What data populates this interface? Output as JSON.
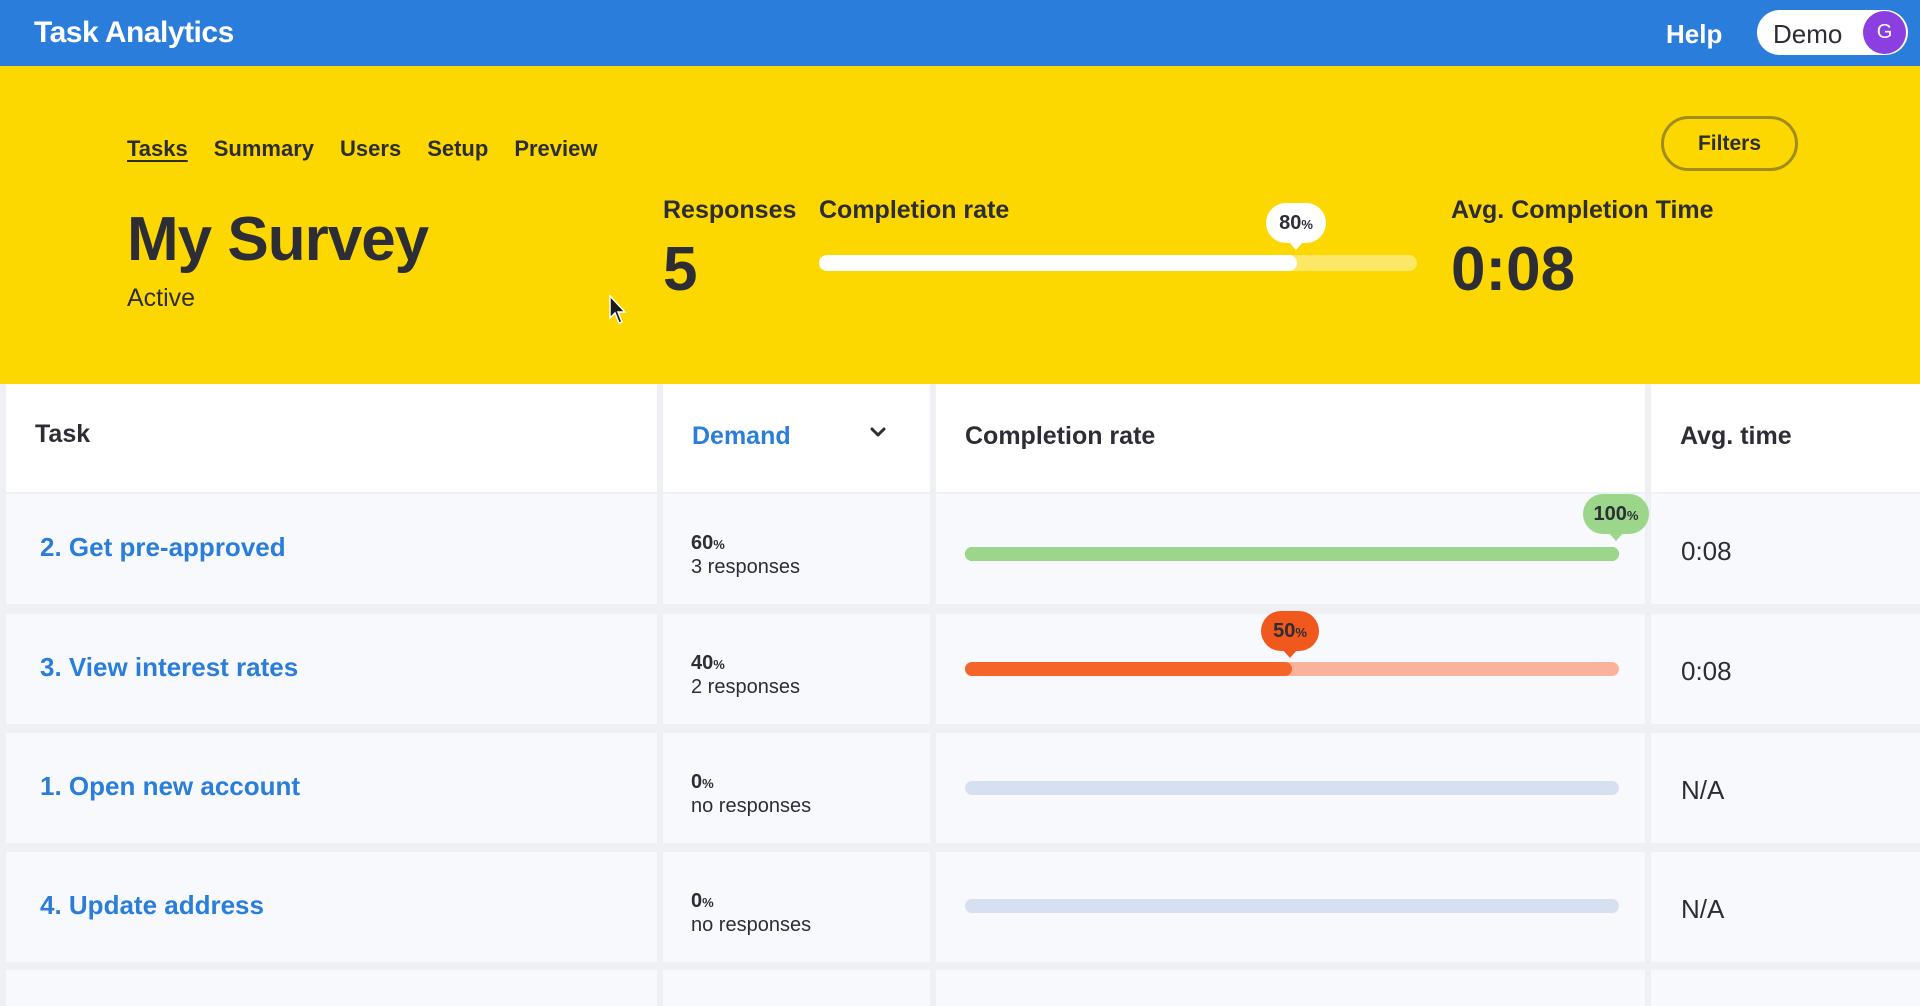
{
  "header": {
    "app_title": "Task Analytics",
    "help_label": "Help",
    "user_name": "Demo",
    "user_initial": "G"
  },
  "nav": {
    "tabs": [
      "Tasks",
      "Summary",
      "Users",
      "Setup",
      "Preview"
    ],
    "active_tab": "Tasks"
  },
  "filters_label": "Filters",
  "survey": {
    "title": "My Survey",
    "status": "Active"
  },
  "stats": {
    "responses_label": "Responses",
    "responses_value": "5",
    "completion_label": "Completion rate",
    "completion_value": "80",
    "completion_unit": "%",
    "completion_fraction": 0.8,
    "avg_time_label": "Avg. Completion Time",
    "avg_time_value": "0:08"
  },
  "table": {
    "columns": {
      "task": "Task",
      "demand": "Demand",
      "completion": "Completion rate",
      "avg_time": "Avg. time"
    },
    "rows": [
      {
        "task": "2. Get pre-approved",
        "demand_pct": "60",
        "demand_responses": "3 responses",
        "completion_pct": "100",
        "completion_fraction": 1.0,
        "avg_time": "0:08",
        "status": "good"
      },
      {
        "task": "3. View interest rates",
        "demand_pct": "40",
        "demand_responses": "2 responses",
        "completion_pct": "50",
        "completion_fraction": 0.5,
        "avg_time": "0:08",
        "status": "poor"
      },
      {
        "task": "1. Open new account",
        "demand_pct": "0",
        "demand_responses": "no responses",
        "completion_pct": null,
        "completion_fraction": 0,
        "avg_time": "N/A",
        "status": "none"
      },
      {
        "task": "4. Update address",
        "demand_pct": "0",
        "demand_responses": "no responses",
        "completion_pct": null,
        "completion_fraction": 0,
        "avg_time": "N/A",
        "status": "none"
      }
    ]
  },
  "colors": {
    "brand_blue": "#2a7ddb",
    "hero_yellow": "#fdd800",
    "good_fill": "#9bd68a",
    "good_bubble": "#9bd68a",
    "poor_fill": "#f5652a",
    "poor_track": "#fbb29b",
    "poor_bubble": "#f0581e",
    "empty_track": "#d7e0f1"
  },
  "icons": {
    "sort": "chevron-down-icon",
    "cursor": "mouse-pointer-icon"
  }
}
